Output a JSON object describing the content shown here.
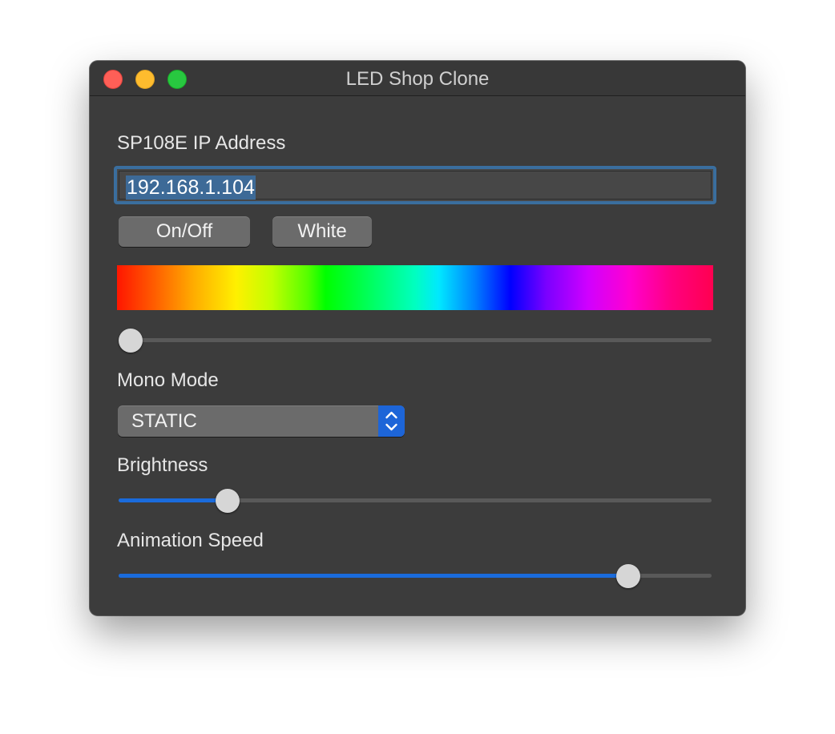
{
  "window": {
    "title": "LED Shop Clone"
  },
  "ip": {
    "label": "SP108E IP Address",
    "value": "192.168.1.104",
    "selected": true
  },
  "buttons": {
    "on_off": "On/Off",
    "white": "White"
  },
  "color": {
    "hue_slider_value": 0.0
  },
  "mono_mode": {
    "label": "Mono Mode",
    "selected": "STATIC"
  },
  "brightness": {
    "label": "Brightness",
    "value": 0.17
  },
  "animation_speed": {
    "label": "Animation Speed",
    "value": 0.875
  },
  "colors": {
    "accent": "#1a6bdc",
    "window_bg": "#3c3c3c",
    "close": "#fe5f57",
    "minimize": "#febc2e",
    "maximize": "#28c840"
  },
  "icons": {
    "popup_arrows": "chevron-up-down-icon"
  }
}
